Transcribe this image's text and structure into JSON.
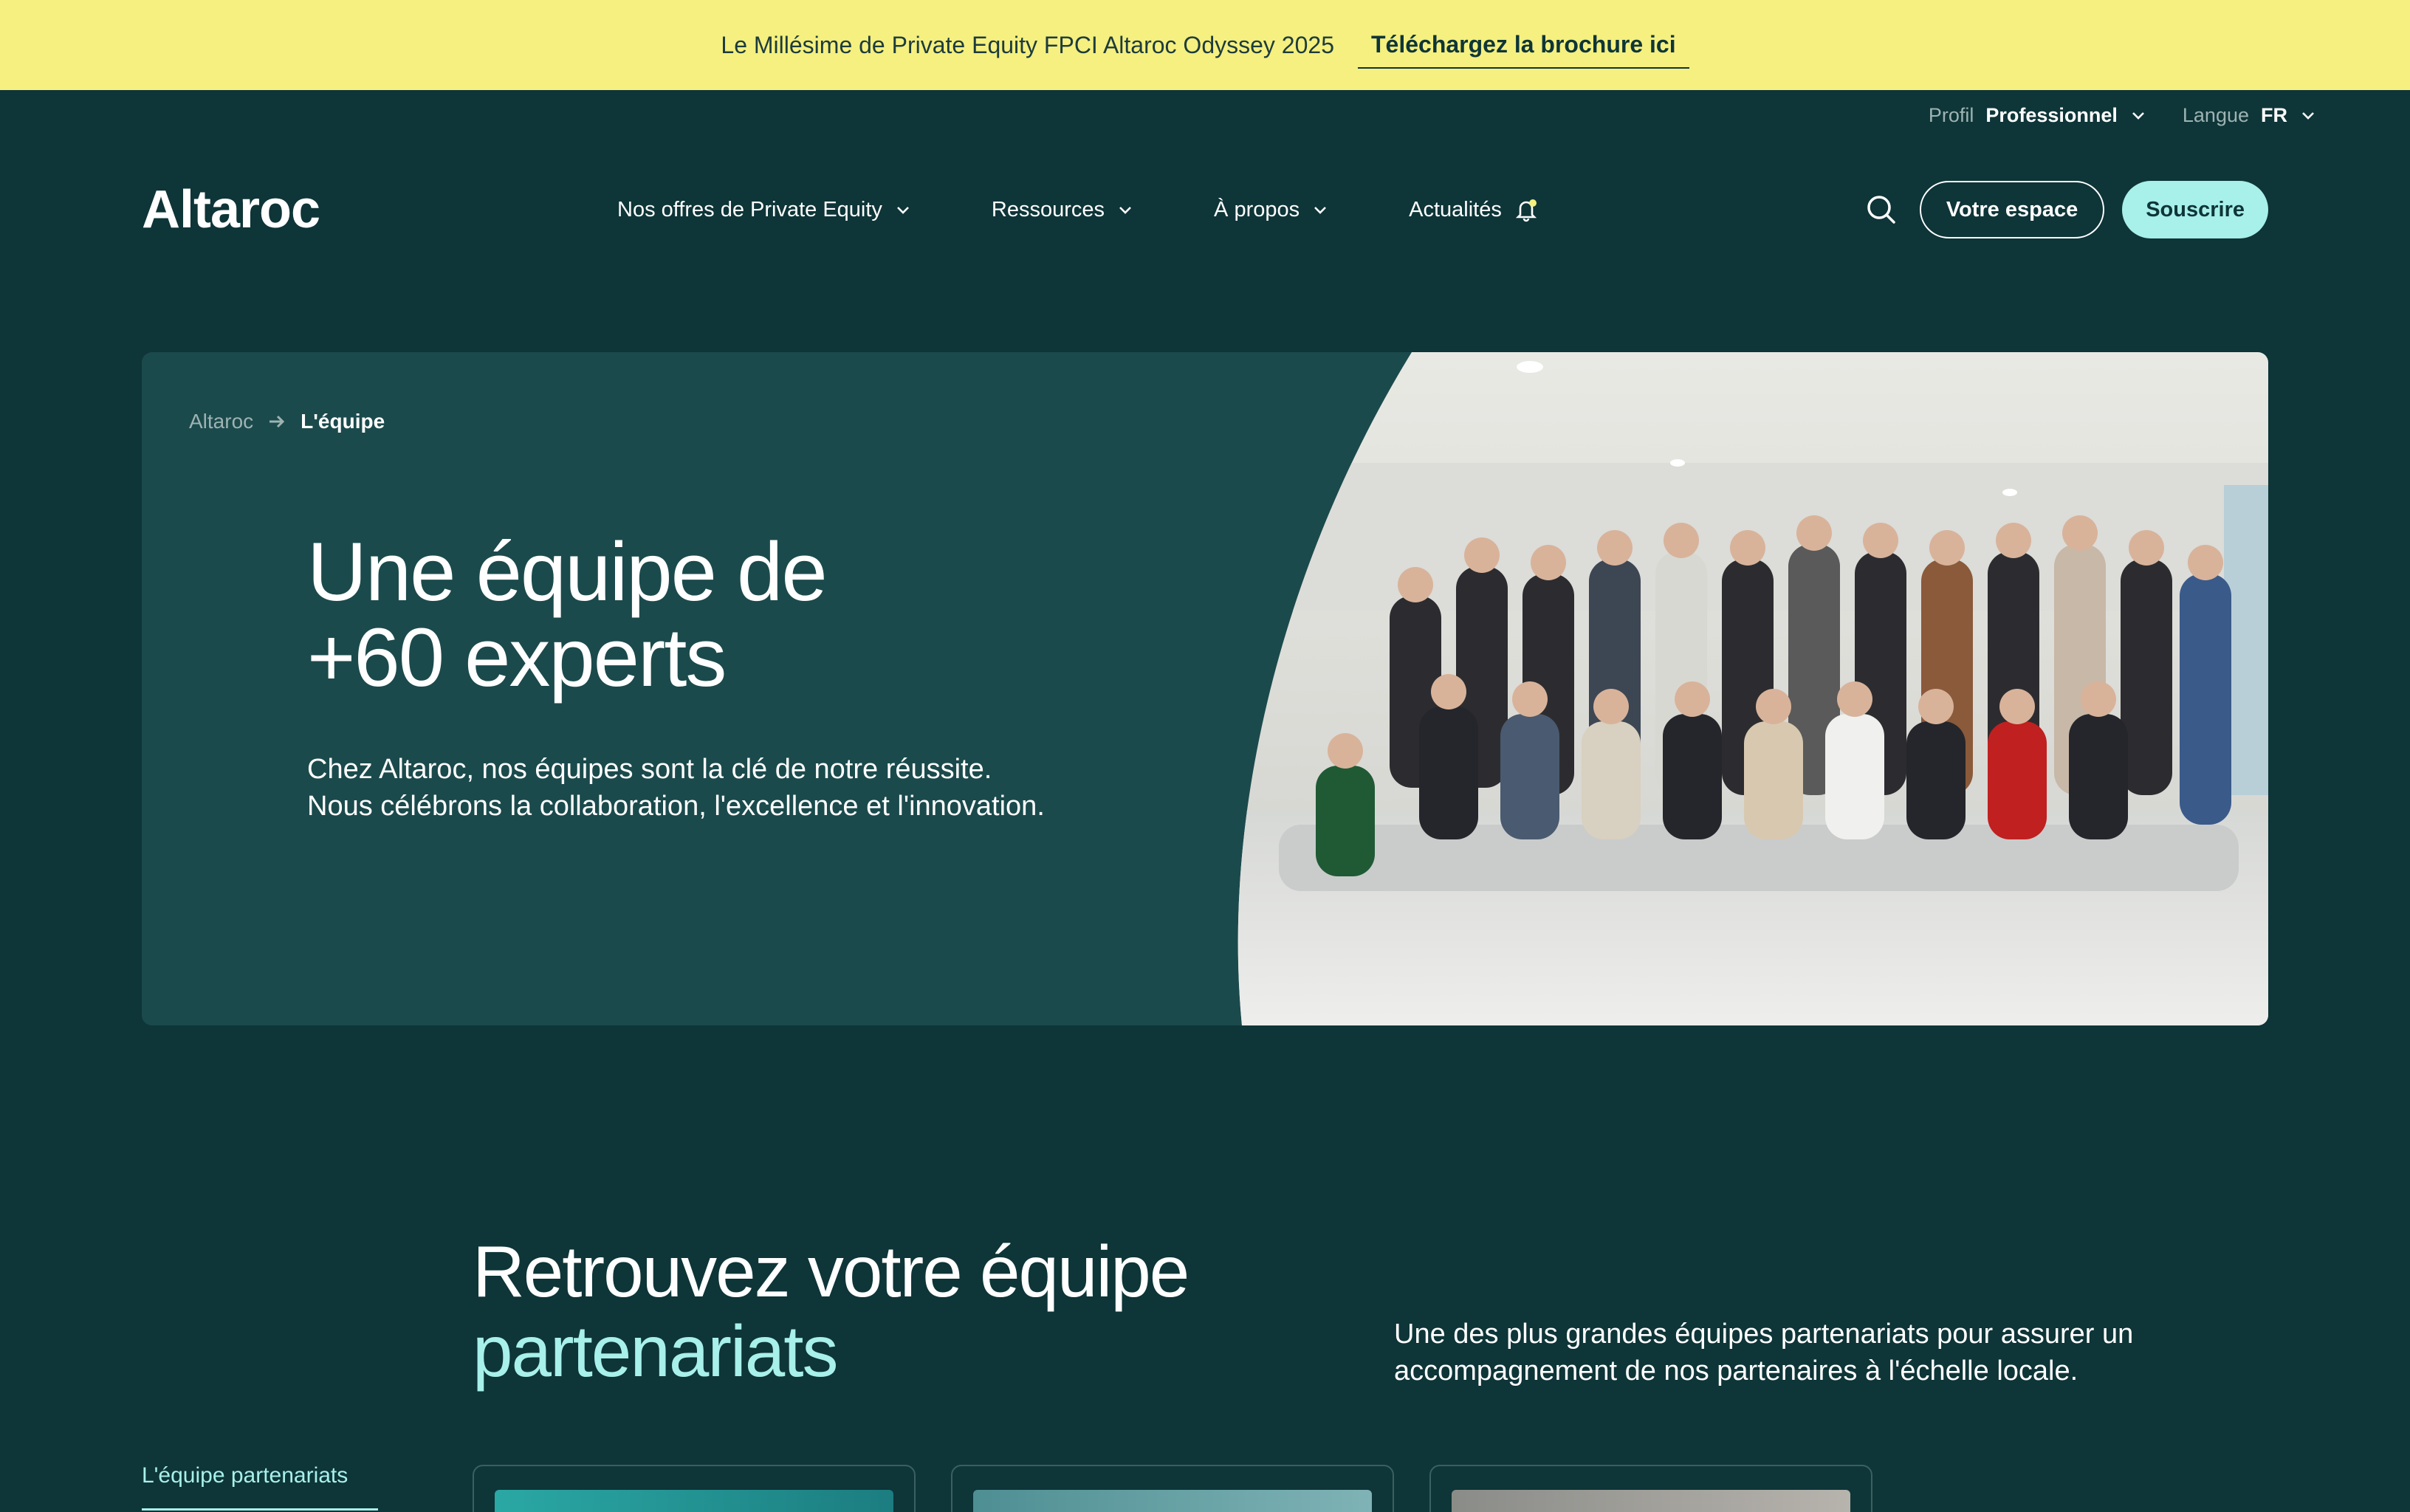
{
  "announcement": {
    "text": "Le Millésime de Private Equity FPCI Altaroc Odyssey 2025",
    "link_label": "Téléchargez la brochure ici"
  },
  "utility": {
    "profile_label": "Profil",
    "profile_value": "Professionnel",
    "language_label": "Langue",
    "language_value": "FR"
  },
  "nav": {
    "logo": "Altaroc",
    "items": [
      {
        "label": "Nos offres de Private Equity",
        "icon": "chevron-down-icon"
      },
      {
        "label": "Ressources",
        "icon": "chevron-down-icon"
      },
      {
        "label": "À propos",
        "icon": "chevron-down-icon"
      },
      {
        "label": "Actualités",
        "icon": "bell-icon"
      }
    ],
    "space_button": "Votre espace",
    "subscribe_button": "Souscrire"
  },
  "hero": {
    "breadcrumb_home": "Altaroc",
    "breadcrumb_current": "L'équipe",
    "title_line1": "Une équipe de",
    "title_line2": "+60 experts",
    "subtitle_line1": "Chez Altaroc, nos équipes sont la clé de notre réussite.",
    "subtitle_line2": "Nous célébrons la collaboration, l'excellence et l'innovation."
  },
  "section": {
    "title_line1": "Retrouvez votre équipe",
    "title_accent": "partenariats",
    "description_line1": "Une des plus grandes équipes partenariats pour assurer un",
    "description_line2": "accompagnement de nos partenaires à l'échelle locale.",
    "side_tab": "L'équipe partenariats"
  },
  "colors": {
    "background": "#0e3538",
    "announcement": "#f5f07f",
    "hero_panel": "#1b4a4c",
    "accent": "#a8f0ea"
  }
}
